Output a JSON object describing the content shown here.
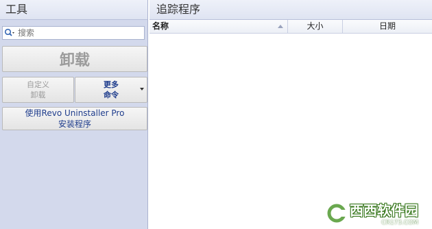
{
  "tools_panel": {
    "title": "工具",
    "search": {
      "placeholder": "搜索"
    },
    "uninstall_label": "卸载",
    "custom_uninstall": {
      "line1": "自定义",
      "line2": "卸载"
    },
    "more_commands": {
      "line1": "更多",
      "line2": "命令"
    },
    "pro_install": {
      "line1": "使用Revo Uninstaller Pro",
      "line2": "安装程序"
    }
  },
  "tracked_panel": {
    "title": "追踪程序",
    "columns": [
      "名称",
      "大小",
      "日期"
    ]
  },
  "watermark": {
    "text": "西西软件园",
    "sub": "CR173.COM"
  },
  "colors": {
    "panel_bg": "#d3d9ec",
    "accent_text": "#1e3c8c",
    "disabled_text": "#9b9b9b"
  },
  "icons": {
    "search": "search-icon",
    "dropdown": "chevron-down-icon"
  }
}
